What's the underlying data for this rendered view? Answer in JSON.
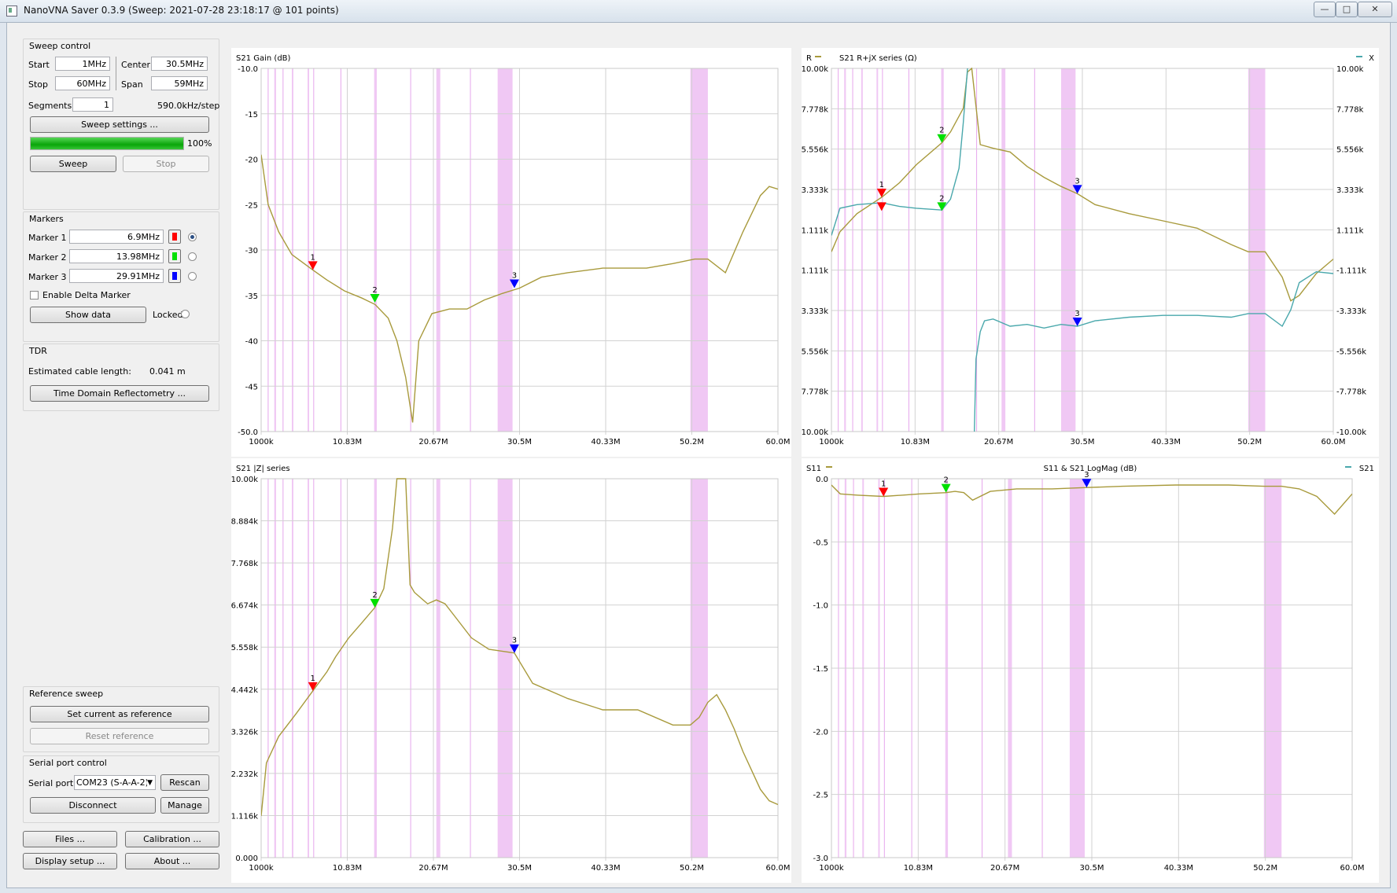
{
  "window": {
    "title": "NanoVNA Saver 0.3.9 (Sweep: 2021-07-28 23:18:17 @ 101 points)",
    "controls": [
      "—",
      "□",
      "✕"
    ]
  },
  "sweep_control": {
    "title": "Sweep control",
    "start_label": "Start",
    "start_value": "1MHz",
    "stop_label": "Stop",
    "stop_value": "60MHz",
    "center_label": "Center",
    "center_value": "30.5MHz",
    "span_label": "Span",
    "span_value": "59MHz",
    "segments_label": "Segments",
    "segments_value": "1",
    "step_text": "590.0kHz/step",
    "settings_button": "Sweep settings ...",
    "progress_percent": 100,
    "progress_text": "100%",
    "sweep_button": "Sweep",
    "stop_button": "Stop"
  },
  "markers": {
    "title": "Markers",
    "items": [
      {
        "label": "Marker 1",
        "value": "6.9MHz",
        "color": "#ff0000",
        "selected": true
      },
      {
        "label": "Marker 2",
        "value": "13.98MHz",
        "color": "#00e000",
        "selected": false
      },
      {
        "label": "Marker 3",
        "value": "29.91MHz",
        "color": "#0000ff",
        "selected": false
      }
    ],
    "delta_label": "Enable Delta Marker",
    "show_data_button": "Show data",
    "locked_label": "Locked"
  },
  "tdr": {
    "title": "TDR",
    "cable_label": "Estimated cable length:",
    "cable_value": "0.041 m",
    "tdr_button": "Time Domain Reflectometry ..."
  },
  "reference_sweep": {
    "title": "Reference sweep",
    "set_button": "Set current as reference",
    "reset_button": "Reset reference"
  },
  "serial_port": {
    "title": "Serial port control",
    "port_label": "Serial port",
    "port_value": "COM23 (S-A-A-2)",
    "rescan_button": "Rescan",
    "disconnect_button": "Disconnect",
    "manage_button": "Manage"
  },
  "bottom_buttons": {
    "files": "Files ...",
    "calibration": "Calibration ...",
    "display_setup": "Display setup ...",
    "about": "About ..."
  },
  "colors": {
    "trace": "#a89a3c",
    "trace2": "#4aa8ac",
    "band": "#f0c8f4",
    "band_line": "#e6a6ec",
    "grid": "#d2d2d2",
    "marker1": "#ff0000",
    "marker2": "#00e000",
    "marker3": "#0000ff"
  },
  "chart_data": [
    {
      "type": "line",
      "title": "S21 Gain (dB)",
      "x_ticks": [
        "1000k",
        "10.83M",
        "20.67M",
        "30.5M",
        "40.33M",
        "50.2M",
        "60.0M"
      ],
      "y_ticks": [
        "-10.0",
        "-15",
        "-20",
        "-25",
        "-30",
        "-35",
        "-40",
        "-45",
        "-50.0"
      ],
      "xlim": [
        1,
        60
      ],
      "ylim": [
        -50,
        -10
      ],
      "series": [
        {
          "x": [
            1,
            1.8,
            3,
            4.5,
            6.9,
            8.5,
            10.5,
            12.5,
            14,
            15.5,
            16.5,
            17.5,
            18.3,
            19,
            20.5,
            22.5,
            24.5,
            26.5,
            28.5,
            30.5,
            33,
            36,
            40,
            45,
            48,
            50.5,
            52,
            54,
            56,
            58,
            59,
            60
          ],
          "y": [
            -19.5,
            -25,
            -28,
            -30.5,
            -32.2,
            -33.3,
            -34.5,
            -35.3,
            -36,
            -37.5,
            -40,
            -44,
            -49,
            -40,
            -37,
            -36.5,
            -36.5,
            -35.5,
            -34.8,
            -34.2,
            -33,
            -32.5,
            -32,
            -32,
            -31.5,
            -31,
            -31,
            -32.5,
            -28,
            -24,
            -23,
            -23.3
          ]
        }
      ],
      "markers": [
        {
          "label": "1",
          "x": 6.9,
          "y": -32.2
        },
        {
          "label": "2",
          "x": 13.98,
          "y": -35.8
        },
        {
          "label": "3",
          "x": 29.91,
          "y": -34.2
        }
      ],
      "bands": [
        [
          2.5,
          2.7
        ],
        [
          4.5,
          4.6
        ],
        [
          6.3,
          6.4
        ],
        [
          13.9,
          14.2
        ],
        [
          21.0,
          21.45
        ],
        [
          28.0,
          29.7
        ],
        [
          50.0,
          52.0
        ]
      ],
      "band_lines": [
        1.8,
        3.5,
        7.0,
        10.1,
        18.07,
        24.89
      ]
    },
    {
      "type": "line",
      "title": "S21 R+jX series (Ω)",
      "legend": [
        "R",
        "X"
      ],
      "x_ticks": [
        "1000k",
        "10.83M",
        "20.67M",
        "30.5M",
        "40.33M",
        "50.2M",
        "60.0M"
      ],
      "y_ticks": [
        "10.00k",
        "7.778k",
        "5.556k",
        "3.333k",
        "1.111k",
        "-1.111k",
        "-3.333k",
        "-5.556k",
        "-7.778k",
        "-10.00k"
      ],
      "xlim": [
        1,
        60
      ],
      "ylim": [
        -10000,
        10000
      ],
      "series": [
        {
          "name": "R",
          "x": [
            1,
            2,
            4,
            6.9,
            9,
            11,
            13.98,
            15,
            16.5,
            17,
            17.5,
            18.5,
            20,
            22,
            24,
            26,
            28,
            29.91,
            32,
            36,
            40,
            44,
            48,
            50,
            52,
            54,
            55,
            56,
            58,
            60
          ],
          "y": [
            -100,
            1000,
            2000,
            2900,
            3700,
            4700,
            5900,
            6500,
            7800,
            9800,
            10000,
            5800,
            5600,
            5400,
            4600,
            4000,
            3500,
            3100,
            2500,
            2000,
            1600,
            1200,
            300,
            -100,
            -100,
            -1500,
            -2800,
            -2500,
            -1300,
            -500
          ]
        },
        {
          "name": "X",
          "x": [
            1,
            2,
            4,
            6.9,
            9,
            11,
            13.98,
            15,
            16,
            16.5,
            17,
            17.5,
            17.8,
            18,
            18.5,
            19,
            20,
            22,
            24,
            26,
            28,
            29.91,
            32,
            36,
            40,
            44,
            48,
            50,
            52,
            54,
            55,
            56,
            58,
            60
          ],
          "y": [
            800,
            2300,
            2500,
            2600,
            2400,
            2300,
            2200,
            2800,
            4500,
            7000,
            10000,
            null,
            -10000,
            -6000,
            -4500,
            -3900,
            -3800,
            -4200,
            -4100,
            -4300,
            -4100,
            -4200,
            -3900,
            -3700,
            -3600,
            -3600,
            -3700,
            -3500,
            -3500,
            -4200,
            -3300,
            -1800,
            -1200,
            -1300
          ]
        }
      ],
      "markers": [
        {
          "label": "1",
          "x": 6.9,
          "y": 2900
        },
        {
          "label": "",
          "x": 6.9,
          "y": 2150
        },
        {
          "label": "2",
          "x": 13.98,
          "y": 5900
        },
        {
          "label": "2",
          "x": 13.98,
          "y": 2150
        },
        {
          "label": "3",
          "x": 29.91,
          "y": 3100
        },
        {
          "label": "3",
          "x": 29.91,
          "y": -4200
        }
      ],
      "bands": [
        [
          2.5,
          2.7
        ],
        [
          4.5,
          4.6
        ],
        [
          6.3,
          6.4
        ],
        [
          13.9,
          14.2
        ],
        [
          21.0,
          21.45
        ],
        [
          28.0,
          29.7
        ],
        [
          50.0,
          52.0
        ]
      ],
      "band_lines": [
        1.8,
        3.5,
        7.0,
        10.1,
        18.07,
        24.89
      ]
    },
    {
      "type": "line",
      "title": "S21 |Z| series",
      "x_ticks": [
        "1000k",
        "10.83M",
        "20.67M",
        "30.5M",
        "40.33M",
        "50.2M",
        "60.0M"
      ],
      "y_ticks": [
        "10.00k",
        "8.884k",
        "7.768k",
        "6.674k",
        "5.558k",
        "4.442k",
        "3.326k",
        "2.232k",
        "1.116k",
        "0.000"
      ],
      "xlim": [
        1,
        60
      ],
      "ylim": [
        0,
        10000
      ],
      "series": [
        {
          "x": [
            1,
            1.6,
            3,
            5,
            6.9,
            8.5,
            9.5,
            11,
            12.5,
            13.98,
            15,
            16,
            16.5,
            17.5,
            18,
            18.5,
            19,
            20,
            21,
            22,
            23,
            25,
            27,
            29.91,
            32,
            36,
            40,
            44,
            48,
            50,
            51,
            52,
            53,
            54,
            55,
            56,
            57,
            58,
            59,
            60
          ],
          "y": [
            1100,
            2500,
            3200,
            3800,
            4400,
            4900,
            5300,
            5800,
            6200,
            6600,
            7100,
            8700,
            10000,
            10000,
            7200,
            7000,
            6900,
            6700,
            6800,
            6700,
            6400,
            5800,
            5500,
            5400,
            4600,
            4200,
            3900,
            3900,
            3500,
            3500,
            3700,
            4100,
            4300,
            3900,
            3400,
            2800,
            2300,
            1800,
            1500,
            1400
          ]
        }
      ],
      "markers": [
        {
          "label": "1",
          "x": 6.9,
          "y": 4400
        },
        {
          "label": "2",
          "x": 13.98,
          "y": 6600
        },
        {
          "label": "3",
          "x": 29.91,
          "y": 5400
        }
      ],
      "bands": [
        [
          2.5,
          2.7
        ],
        [
          4.5,
          4.6
        ],
        [
          6.3,
          6.4
        ],
        [
          13.9,
          14.2
        ],
        [
          21.0,
          21.45
        ],
        [
          28.0,
          29.7
        ],
        [
          50.0,
          52.0
        ]
      ],
      "band_lines": [
        1.8,
        3.5,
        7.0,
        10.1,
        18.07,
        24.89
      ]
    },
    {
      "type": "line",
      "title": "S11 & S21 LogMag (dB)",
      "legend": [
        "S11",
        "S21"
      ],
      "x_ticks": [
        "1000k",
        "10.83M",
        "20.67M",
        "30.5M",
        "40.33M",
        "50.2M",
        "60.0M"
      ],
      "y_ticks": [
        "0.0",
        "-0.5",
        "-1.0",
        "-1.5",
        "-2.0",
        "-2.5",
        "-3.0"
      ],
      "xlim": [
        1,
        60
      ],
      "ylim": [
        -3,
        0
      ],
      "series": [
        {
          "name": "S11",
          "x": [
            1,
            2,
            4,
            6.9,
            9,
            11,
            13.98,
            15,
            16,
            17,
            19,
            22,
            26,
            29.91,
            34,
            40,
            46,
            50,
            52,
            54,
            56,
            58,
            60
          ],
          "y": [
            -0.05,
            -0.12,
            -0.13,
            -0.14,
            -0.13,
            -0.12,
            -0.11,
            -0.1,
            -0.11,
            -0.17,
            -0.1,
            -0.08,
            -0.08,
            -0.07,
            -0.06,
            -0.05,
            -0.05,
            -0.06,
            -0.06,
            -0.08,
            -0.14,
            -0.28,
            -0.12
          ]
        }
      ],
      "markers": [
        {
          "label": "1",
          "x": 6.9,
          "y": -0.14
        },
        {
          "label": "2",
          "x": 13.98,
          "y": -0.11
        },
        {
          "label": "3",
          "x": 29.91,
          "y": -0.07
        }
      ],
      "bands": [
        [
          2.5,
          2.7
        ],
        [
          4.5,
          4.6
        ],
        [
          6.3,
          6.4
        ],
        [
          13.9,
          14.2
        ],
        [
          21.0,
          21.45
        ],
        [
          28.0,
          29.7
        ],
        [
          50.0,
          52.0
        ]
      ],
      "band_lines": [
        1.8,
        3.5,
        7.0,
        10.1,
        18.07,
        24.89
      ]
    }
  ]
}
